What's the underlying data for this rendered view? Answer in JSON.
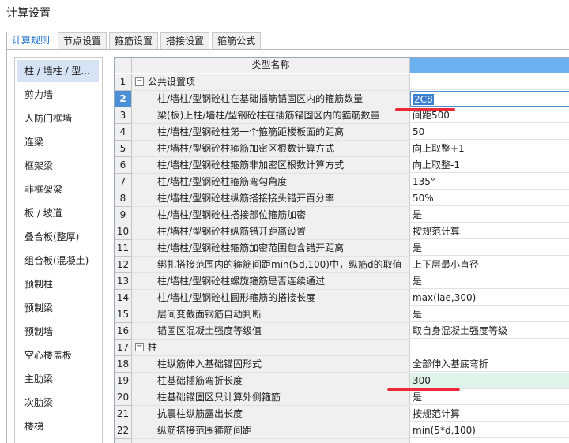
{
  "window": {
    "title": "计算设置"
  },
  "tabs": [
    {
      "label": "计算规则",
      "active": true
    },
    {
      "label": "节点设置",
      "active": false
    },
    {
      "label": "箍筋设置",
      "active": false
    },
    {
      "label": "搭接设置",
      "active": false
    },
    {
      "label": "箍筋公式",
      "active": false
    }
  ],
  "sidebar": {
    "selected_index": 0,
    "items": [
      "柱 / 墙柱 / 型...",
      "剪力墙",
      "人防门框墙",
      "连梁",
      "框架梁",
      "非框架梁",
      "板 / 坡道",
      "叠合板(整厚)",
      "组合板(混凝土)",
      "预制柱",
      "预制梁",
      "预制墙",
      "空心楼盖板",
      "主肋梁",
      "次肋梁",
      "楼梯"
    ]
  },
  "grid": {
    "header_name": "类型名称",
    "current_row": 2,
    "rows": [
      {
        "num": "1",
        "group": true,
        "expander": "−",
        "name": "公共设置项",
        "value": ""
      },
      {
        "num": "2",
        "name": "柱/墙柱/型钢砼柱在基础插筋锚固区内的箍筋数量",
        "value": "2C8",
        "editing": true
      },
      {
        "num": "3",
        "name": "梁(板)上柱/墙柱/型钢砼柱在插筋锚固区内的箍筋数量",
        "value": "间距500"
      },
      {
        "num": "4",
        "name": "柱/墙柱/型钢砼柱第一个箍筋距楼板面的距离",
        "value": "50"
      },
      {
        "num": "5",
        "name": "柱/墙柱/型钢砼柱箍筋加密区根数计算方式",
        "value": "向上取整+1"
      },
      {
        "num": "6",
        "name": "柱/墙柱/型钢砼柱箍筋非加密区根数计算方式",
        "value": "向上取整-1"
      },
      {
        "num": "7",
        "name": "柱/墙柱/型钢砼柱箍筋弯勾角度",
        "value": "135°"
      },
      {
        "num": "8",
        "name": "柱/墙柱/型钢砼柱纵筋搭接接头错开百分率",
        "value": "50%"
      },
      {
        "num": "9",
        "name": "柱/墙柱/型钢砼柱搭接部位箍筋加密",
        "value": "是"
      },
      {
        "num": "10",
        "name": "柱/墙柱/型钢砼柱纵筋错开距离设置",
        "value": "按规范计算"
      },
      {
        "num": "11",
        "name": "柱/墙柱/型钢砼柱箍筋加密范围包含错开距离",
        "value": "是"
      },
      {
        "num": "12",
        "name": "绑扎搭接范围内的箍筋间距min(5d,100)中，纵筋d的取值",
        "value": "上下层最小直径"
      },
      {
        "num": "13",
        "name": "柱/墙柱/型钢砼柱螺旋箍筋是否连续通过",
        "value": "是"
      },
      {
        "num": "14",
        "name": "柱/墙柱/型钢砼柱圆形箍筋的搭接长度",
        "value": "max(lae,300)"
      },
      {
        "num": "15",
        "name": "层间变截面钢筋自动判断",
        "value": "是"
      },
      {
        "num": "16",
        "name": "锚固区混凝土强度等级值",
        "value": "取自身混凝土强度等级"
      },
      {
        "num": "17",
        "group": true,
        "expander": "−",
        "name": "柱",
        "value": ""
      },
      {
        "num": "18",
        "name": "柱纵筋伸入基础锚固形式",
        "value": "全部伸入基底弯折"
      },
      {
        "num": "19",
        "name": "柱基础插筋弯折长度",
        "value": "300",
        "highlight": true
      },
      {
        "num": "20",
        "name": "柱基础锚固区只计算外侧箍筋",
        "value": "是"
      },
      {
        "num": "21",
        "name": "抗震柱纵筋露出长度",
        "value": "按规范计算"
      },
      {
        "num": "22",
        "name": "纵筋搭接范围箍筋间距",
        "value": "min(5*d,100)"
      },
      {
        "num": "23",
        "name": "",
        "value": ""
      }
    ]
  },
  "colors": {
    "accent": "#1a6fc9",
    "header_value": "#6cb2f0",
    "annotation": "#ee2a39",
    "highlight_cell": "#dff3ea"
  }
}
